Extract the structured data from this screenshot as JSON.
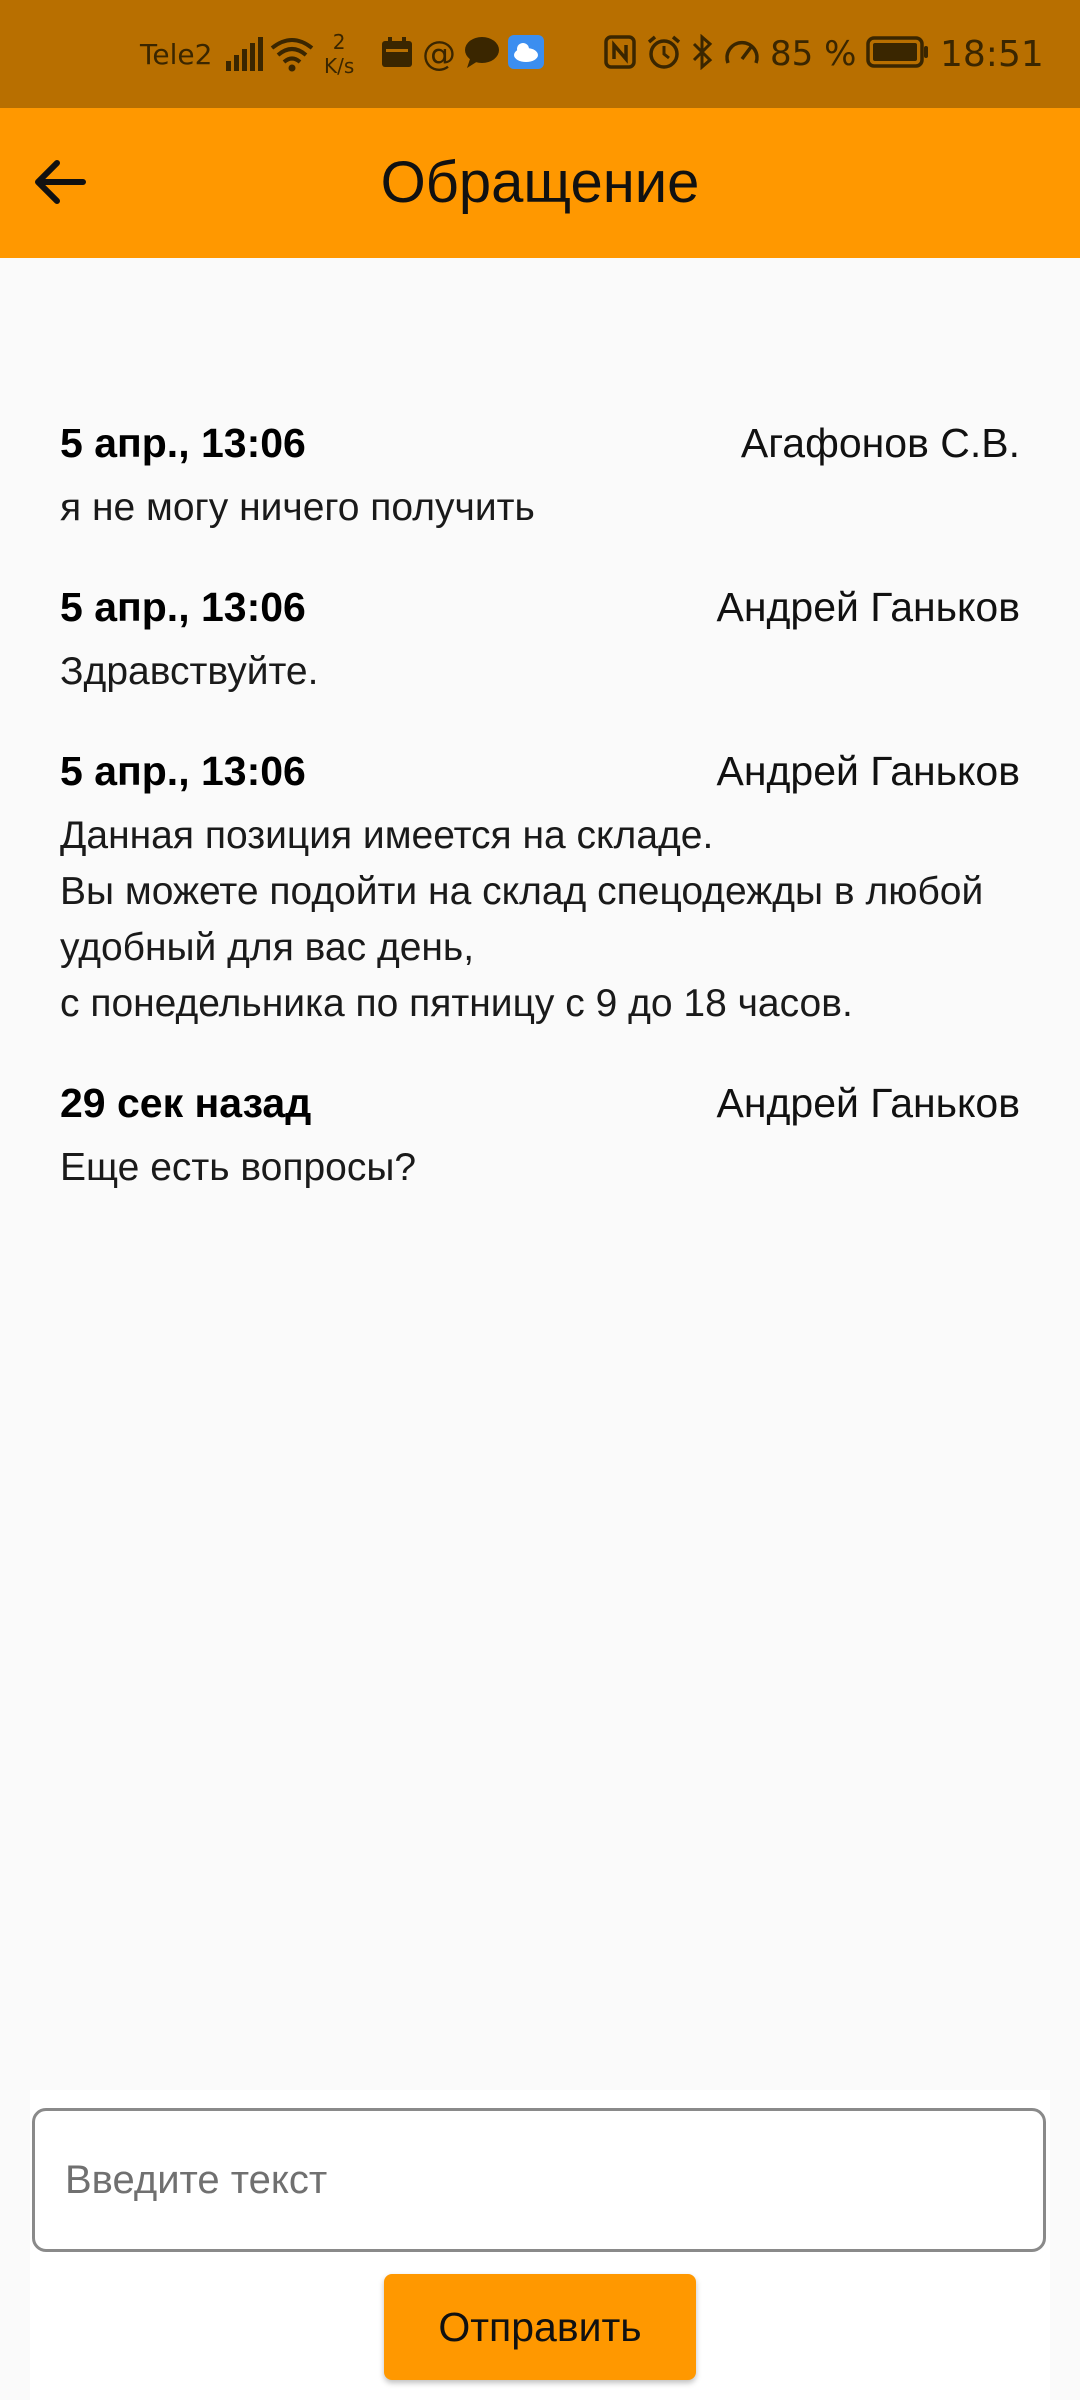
{
  "status_bar": {
    "carrier": "Tele2",
    "net_speed_value": "2",
    "net_speed_unit": "K/s",
    "battery_text": "85 %",
    "time": "18:51",
    "icons": [
      "signal-icon",
      "wifi-icon",
      "calendar-icon",
      "at-icon",
      "chat-icon",
      "cloud-icon",
      "nfc-icon",
      "alarm-icon",
      "bluetooth-icon",
      "speed-icon",
      "battery-icon"
    ]
  },
  "app_bar": {
    "title": "Обращение",
    "back_icon": "arrow-left-icon",
    "color": "#ff9800"
  },
  "messages": [
    {
      "time": "5 апр., 13:06",
      "author": "Агафонов С.В.",
      "text": "я не могу ничего получить"
    },
    {
      "time": "5 апр., 13:06",
      "author": "Андрей Ганьков",
      "text": "Здравствуйте."
    },
    {
      "time": "5 апр., 13:06",
      "author": "Андрей Ганьков",
      "text": "Данная позиция имеется на складе.\nВы можете подойти на склад спецодежды в любой удобный для вас день,\n с понедельника по пятницу с 9 до 18 часов."
    },
    {
      "time": "29 сек назад",
      "author": "Андрей Ганьков",
      "text": "Еще есть вопросы?"
    }
  ],
  "composer": {
    "placeholder": "Введите текст",
    "value": "",
    "send_label": "Отправить"
  }
}
